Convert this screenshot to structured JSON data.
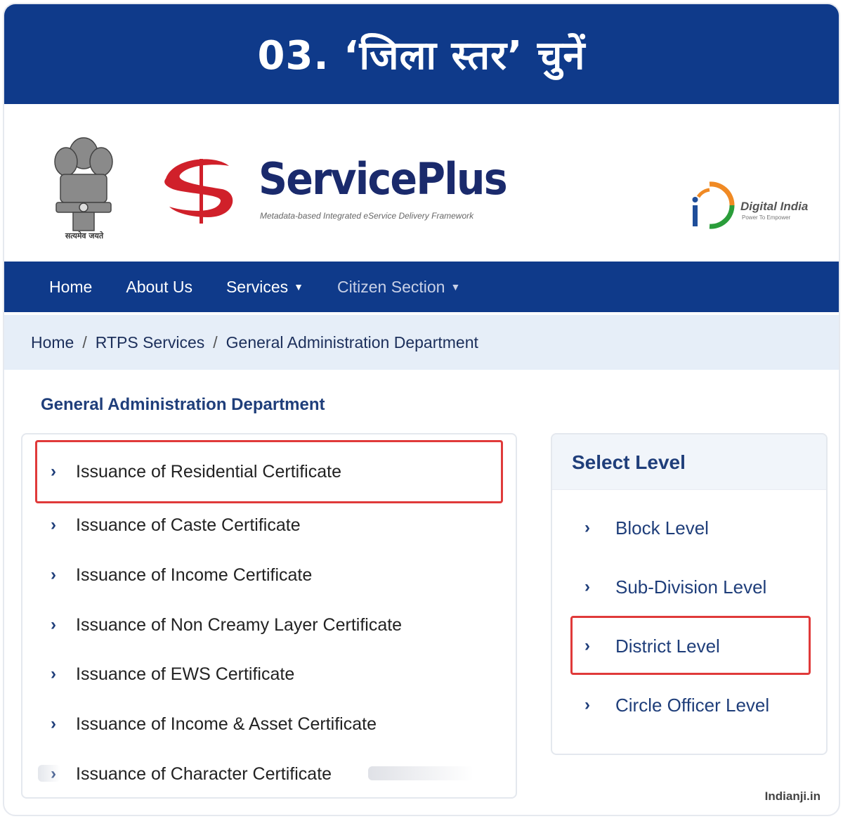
{
  "step": {
    "title": "03. ‘जिला स्तर’ चुनें"
  },
  "brand": {
    "emblem_caption": "सत्यमेव जयते",
    "name": "ServicePlus",
    "tagline": "Metadata-based Integrated eService Delivery Framework",
    "digital_india": "Digital India",
    "digital_india_tagline": "Power To Empower"
  },
  "nav": {
    "items": [
      {
        "label": "Home"
      },
      {
        "label": "About Us"
      },
      {
        "label": "Services"
      },
      {
        "label": "Citizen Section"
      }
    ]
  },
  "breadcrumb": {
    "items": [
      "Home",
      "RTPS Services",
      "General Administration Department"
    ],
    "separator": "/"
  },
  "department": {
    "heading": "General Administration Department",
    "services": [
      {
        "label": "Issuance of Residential Certificate",
        "highlighted": true
      },
      {
        "label": "Issuance of Caste Certificate"
      },
      {
        "label": "Issuance of Income Certificate"
      },
      {
        "label": "Issuance of Non Creamy Layer Certificate"
      },
      {
        "label": "Issuance of EWS Certificate"
      },
      {
        "label": "Issuance of Income & Asset Certificate"
      },
      {
        "label": "Issuance of Character Certificate"
      }
    ]
  },
  "levels": {
    "title": "Select Level",
    "items": [
      {
        "label": "Block Level"
      },
      {
        "label": "Sub-Division Level"
      },
      {
        "label": "District Level",
        "highlighted": true
      },
      {
        "label": "Circle Officer Level"
      }
    ]
  },
  "icons": {
    "chevron": "chevron-right-icon",
    "caret": "caret-down-icon"
  },
  "colors": {
    "primary": "#0f3a8a",
    "highlight": "#e03a3a",
    "breadcrumb_bg": "#e6eef8"
  },
  "watermark": "Indianji.in"
}
